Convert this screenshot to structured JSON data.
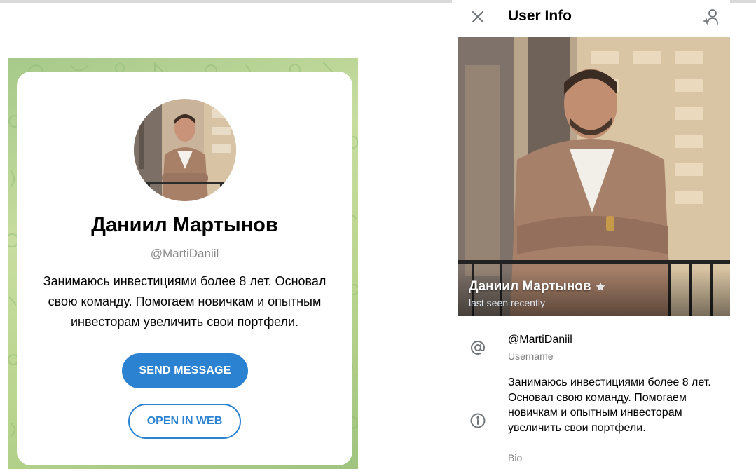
{
  "preview_card": {
    "name": "Даниил Мартынов",
    "username": "@MartiDaniil",
    "bio": "Занимаюсь инвестициями более 8 лет. Основал свою команду. Помогаем новичкам и опытным инвесторам увеличить свои портфели.",
    "send_button": "SEND MESSAGE",
    "web_button": "OPEN IN WEB",
    "accent_color": "#2b82d1",
    "background_color": "#b9d58e"
  },
  "user_info": {
    "title": "User Info",
    "name": "Даниил Мартынов",
    "status": "last seen recently",
    "username_value": "@MartiDaniil",
    "username_label": "Username",
    "bio_value": "Занимаюсь инвестициями более 8 лет. Основал свою команду. Помогаем новичкам и опытным инвесторам увеличить свои портфели.",
    "bio_label": "Bio",
    "icons": [
      "close-icon",
      "add-contact-icon",
      "star-icon",
      "at-icon",
      "info-icon"
    ]
  }
}
